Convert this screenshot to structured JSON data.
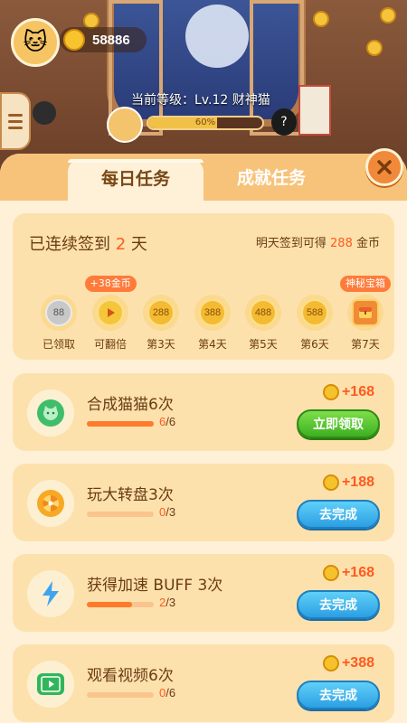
{
  "player": {
    "coins": "58886",
    "level_text": "当前等级：Lv.12 财神猫",
    "level_progress_text": "60%",
    "level_progress": 0.6
  },
  "tabs": [
    {
      "label": "每日任务",
      "active": true
    },
    {
      "label": "成就任务",
      "active": false
    }
  ],
  "checkin": {
    "title_prefix": "已连续签到 ",
    "days_count": "2",
    "title_suffix": " 天",
    "hint_prefix": "明天签到可得 ",
    "hint_amount": "288",
    "hint_suffix": " 金币",
    "days": [
      {
        "value": "88",
        "label": "已领取",
        "state": "done"
      },
      {
        "value": "▶",
        "label": "可翻倍",
        "state": "double",
        "badge": "+38金币"
      },
      {
        "value": "288",
        "label": "第3天",
        "state": "pending"
      },
      {
        "value": "388",
        "label": "第4天",
        "state": "pending"
      },
      {
        "value": "488",
        "label": "第5天",
        "state": "pending"
      },
      {
        "value": "588",
        "label": "第6天",
        "state": "pending"
      },
      {
        "value": "🎁",
        "label": "第7天",
        "state": "chest",
        "badge": "神秘宝箱"
      }
    ]
  },
  "tasks": [
    {
      "title": "合成猫猫6次",
      "done": "6",
      "total": "/6",
      "ratio": 1.0,
      "reward": "+168",
      "button": "立即领取",
      "button_style": "green",
      "icon": "cat-face-icon"
    },
    {
      "title": "玩大转盘3次",
      "done": "0",
      "total": "/3",
      "ratio": 0.0,
      "reward": "+188",
      "button": "去完成",
      "button_style": "blue",
      "icon": "wheel-icon"
    },
    {
      "title": "获得加速 BUFF 3次",
      "done": "2",
      "total": "/3",
      "ratio": 0.67,
      "reward": "+168",
      "button": "去完成",
      "button_style": "blue",
      "icon": "lightning-icon"
    },
    {
      "title": "观看视频6次",
      "done": "0",
      "total": "/6",
      "ratio": 0.0,
      "reward": "+388",
      "button": "去完成",
      "button_style": "blue",
      "icon": "video-icon"
    }
  ],
  "colors": {
    "accent": "#ff5a1f",
    "panel": "#fef1d8",
    "card": "#fde1ad",
    "tab": "#f7c37a"
  }
}
